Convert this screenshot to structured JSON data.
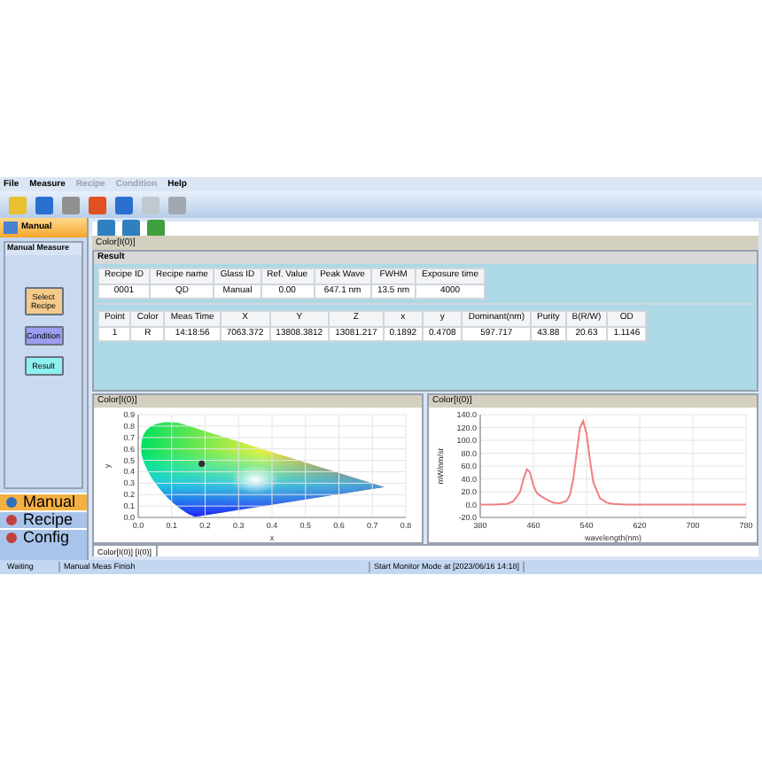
{
  "menu": [
    {
      "label": "File",
      "disabled": false
    },
    {
      "label": "Measure",
      "disabled": false
    },
    {
      "label": "Recipe",
      "disabled": true
    },
    {
      "label": "Condition",
      "disabled": true
    },
    {
      "label": "Help",
      "disabled": false
    }
  ],
  "left_panel": {
    "title": "Manual",
    "tab": "Manual Measure",
    "buttons": [
      {
        "label": "Select Recipe",
        "color": "#f5c98a"
      },
      {
        "label": "Condition",
        "color": "#9c9cf0"
      },
      {
        "label": "Result",
        "color": "#8ef0f0"
      }
    ],
    "nav": [
      {
        "label": "Manual",
        "selected": true
      },
      {
        "label": "Recipe",
        "selected": false
      },
      {
        "label": "Config",
        "selected": false
      }
    ]
  },
  "document_tab": "Color[I(0)]",
  "result": {
    "title": "Result",
    "recipe_table": {
      "columns": [
        "Recipe ID",
        "Recipe name",
        "Glass ID",
        "Ref. Value",
        "Peak Wave",
        "FWHM",
        "Exposure time"
      ],
      "rows": [
        [
          "0001",
          "QD",
          "Manual",
          "0.00",
          "647.1 nm",
          "13.5 nm",
          "4000"
        ]
      ]
    },
    "point_table": {
      "columns": [
        "Point",
        "Color",
        "Meas Time",
        "X",
        "Y",
        "Z",
        "x",
        "y",
        "Dominant(nm)",
        "Purity",
        "B(R/W)",
        "OD"
      ],
      "rows": [
        [
          "1",
          "R",
          "14:18:56",
          "7063.372",
          "13808.3812",
          "13081.217",
          "0.1892",
          "0.4708",
          "597.717",
          "43.88",
          "20.63",
          "1.1146"
        ]
      ]
    }
  },
  "cie_panel": {
    "title": "Color[I(0)]",
    "chart_data": {
      "type": "scatter",
      "xlabel": "x",
      "ylabel": "y",
      "x": [
        0.19
      ],
      "series": [
        {
          "color": "#303030",
          "values": [
            0.47
          ]
        }
      ],
      "grid": true,
      "xlim": [
        0,
        0.8
      ],
      "ylim": [
        0,
        0.9
      ],
      "xticks": [
        {
          "value": 0,
          "label": "0.0"
        },
        {
          "value": 0.1,
          "label": "0.1"
        },
        {
          "value": 0.2,
          "label": "0.2"
        },
        {
          "value": 0.3,
          "label": "0.3"
        },
        {
          "value": 0.4,
          "label": "0.4"
        },
        {
          "value": 0.5,
          "label": "0.5"
        },
        {
          "value": 0.6,
          "label": "0.6"
        },
        {
          "value": 0.7,
          "label": "0.7"
        },
        {
          "value": 0.8,
          "label": "0.8"
        }
      ],
      "yticks": [
        {
          "value": 0,
          "label": "0.0"
        },
        {
          "value": 0.1,
          "label": "0.1"
        },
        {
          "value": 0.2,
          "label": "0.2"
        },
        {
          "value": 0.3,
          "label": "0.3"
        },
        {
          "value": 0.4,
          "label": "0.4"
        },
        {
          "value": 0.5,
          "label": "0.5"
        },
        {
          "value": 0.6,
          "label": "0.6"
        },
        {
          "value": 0.7,
          "label": "0.7"
        },
        {
          "value": 0.8,
          "label": "0.8"
        },
        {
          "value": 0.9,
          "label": "0.9"
        }
      ]
    }
  },
  "spectrum_panel": {
    "title": "Color[I(0)]",
    "chart_data": {
      "type": "line",
      "xlabel": "wavelength(nm)",
      "ylabel": "mW/nm/sr",
      "x": [
        380,
        400,
        420,
        430,
        440,
        445,
        450,
        455,
        460,
        465,
        470,
        480,
        490,
        500,
        510,
        515,
        520,
        525,
        530,
        535,
        540,
        545,
        550,
        560,
        570,
        580,
        600,
        640,
        700,
        780
      ],
      "grid": true,
      "series": [
        {
          "color": "#f08080",
          "values": [
            0,
            0,
            1,
            5,
            20,
            40,
            55,
            50,
            30,
            18,
            14,
            8,
            3,
            2,
            6,
            15,
            40,
            80,
            120,
            130,
            110,
            70,
            35,
            10,
            3,
            1,
            0,
            0,
            0,
            0
          ]
        }
      ],
      "xlim": [
        380,
        780
      ],
      "ylim": [
        -20,
        140
      ],
      "xticks": [
        {
          "value": 380,
          "label": "380"
        },
        {
          "value": 460,
          "label": "460"
        },
        {
          "value": 540,
          "label": "540"
        },
        {
          "value": 620,
          "label": "620"
        },
        {
          "value": 700,
          "label": "700"
        },
        {
          "value": 780,
          "label": "780"
        }
      ],
      "yticks": [
        {
          "value": -20,
          "label": "-20.0"
        },
        {
          "value": 0,
          "label": "0.0"
        },
        {
          "value": 20,
          "label": "20.0"
        },
        {
          "value": 40,
          "label": "40.0"
        },
        {
          "value": 60,
          "label": "60.0"
        },
        {
          "value": 80,
          "label": "80.0"
        },
        {
          "value": 100,
          "label": "100.0"
        },
        {
          "value": 120,
          "label": "120.0"
        },
        {
          "value": 140,
          "label": "140.0"
        }
      ]
    }
  },
  "bottom_tab": "Color[I(0)] [I(0)]",
  "status_bar": [
    "Waiting",
    "Manual Meas  Finish",
    "Start Monitor Mode at [2023/06/16 14:18]"
  ]
}
